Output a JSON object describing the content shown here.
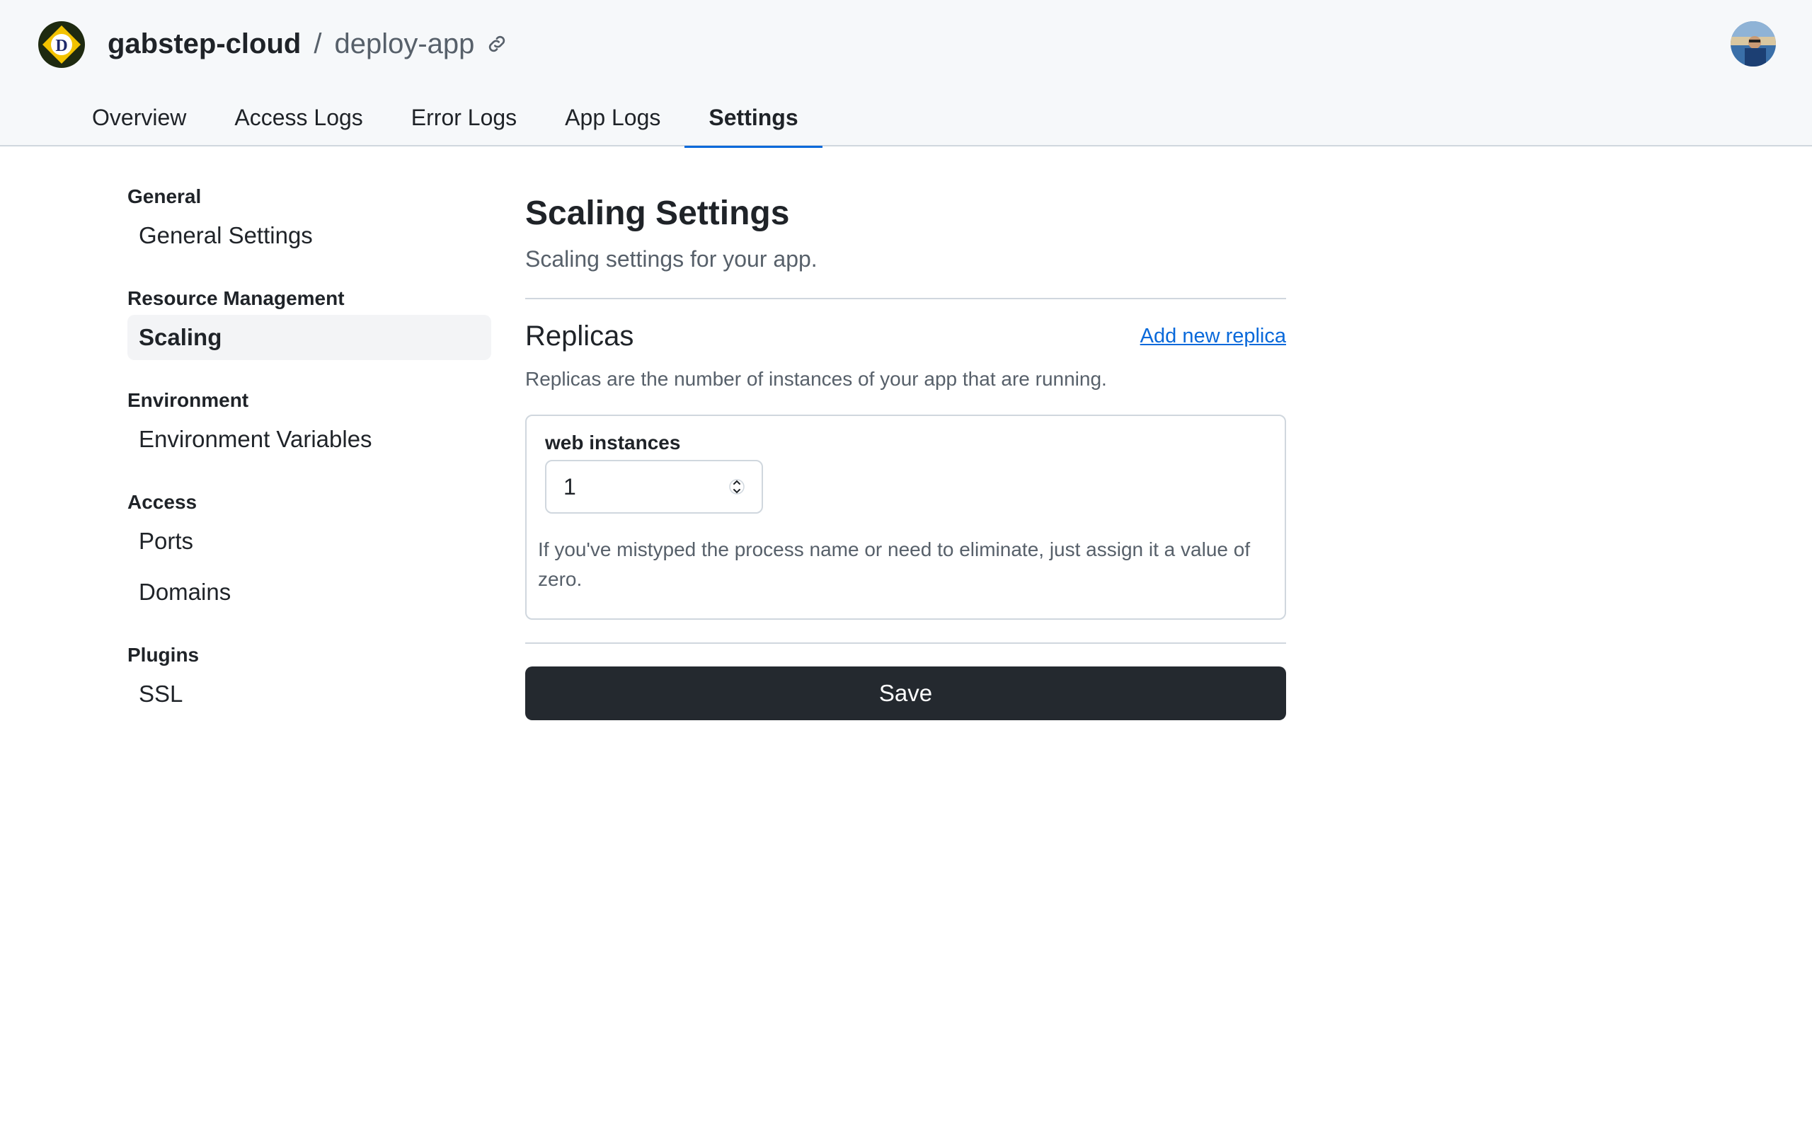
{
  "header": {
    "org": "gabstep-cloud",
    "separator": "/",
    "app": "deploy-app"
  },
  "tabs": [
    {
      "label": "Overview",
      "active": false
    },
    {
      "label": "Access Logs",
      "active": false
    },
    {
      "label": "Error Logs",
      "active": false
    },
    {
      "label": "App Logs",
      "active": false
    },
    {
      "label": "Settings",
      "active": true
    }
  ],
  "sidebar": {
    "groups": [
      {
        "label": "General",
        "items": [
          "General Settings"
        ]
      },
      {
        "label": "Resource Management",
        "items": [
          "Scaling"
        ]
      },
      {
        "label": "Environment",
        "items": [
          "Environment Variables"
        ]
      },
      {
        "label": "Access",
        "items": [
          "Ports",
          "Domains"
        ]
      },
      {
        "label": "Plugins",
        "items": [
          "SSL"
        ]
      }
    ],
    "active_item": "Scaling"
  },
  "main": {
    "title": "Scaling Settings",
    "subtitle": "Scaling settings for your app.",
    "replicas": {
      "title": "Replicas",
      "add_link": "Add new replica",
      "description": "Replicas are the number of instances of your app that are running.",
      "process_label": "web instances",
      "process_value": "1",
      "hint": "If you've mistyped the process name or need to eliminate, just assign it a value of zero."
    },
    "save_label": "Save"
  },
  "colors": {
    "accent": "#0969da",
    "button_bg": "#24292f",
    "header_bg": "#f6f8fa"
  },
  "icons": [
    "logo-icon",
    "link-icon",
    "avatar",
    "spinner-icon"
  ]
}
